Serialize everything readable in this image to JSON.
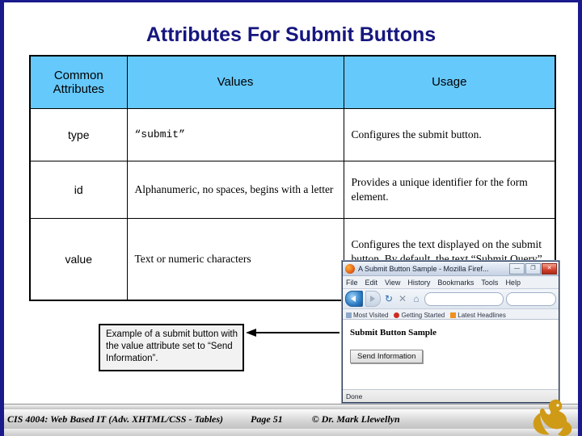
{
  "slide": {
    "title": "Attributes For Submit Buttons",
    "title_color": "#16167f",
    "border_color": "#1a1a8c"
  },
  "table": {
    "header_bg": "#66c9fb",
    "columns": [
      "Common Attributes",
      "Values",
      "Usage"
    ],
    "column_attr_line1": "Common",
    "column_attr_line2": "Attributes",
    "column_values": "Values",
    "column_usage": "Usage",
    "rows": [
      {
        "attribute": "type",
        "values": "“submit”",
        "values_mono": true,
        "usage": "Configures the submit button."
      },
      {
        "attribute": "id",
        "values": "Alphanumeric, no spaces, begins with a letter",
        "values_mono": false,
        "usage": "Provides a unique identifier for the form element."
      },
      {
        "attribute": "value",
        "values": "Text or numeric characters",
        "values_mono": false,
        "usage": "Configures the text displayed on the submit button.  By default, the text “Submit Query” is displayed."
      }
    ]
  },
  "callout": {
    "text": "Example of a submit button with the value attribute set to “Send Information”."
  },
  "browser": {
    "window_title": "A Submit Button Sample - Mozilla Firef...",
    "window_buttons": {
      "minimize": "—",
      "maximize": "❐",
      "close": "✕"
    },
    "menu": [
      "File",
      "Edit",
      "View",
      "History",
      "Bookmarks",
      "Tools",
      "Help"
    ],
    "urlbar_value": "",
    "searchbar_value": "",
    "bookmarks": [
      "Most Visited",
      "Getting Started",
      "Latest Headlines"
    ],
    "page_heading": "Submit Button Sample",
    "submit_button_label": "Send Information",
    "status_text": "Done"
  },
  "footer": {
    "course": "CIS 4004: Web Based IT (Adv. XHTML/CSS - Tables)",
    "page": "Page 51",
    "copyright": "© Dr. Mark Llewellyn"
  }
}
